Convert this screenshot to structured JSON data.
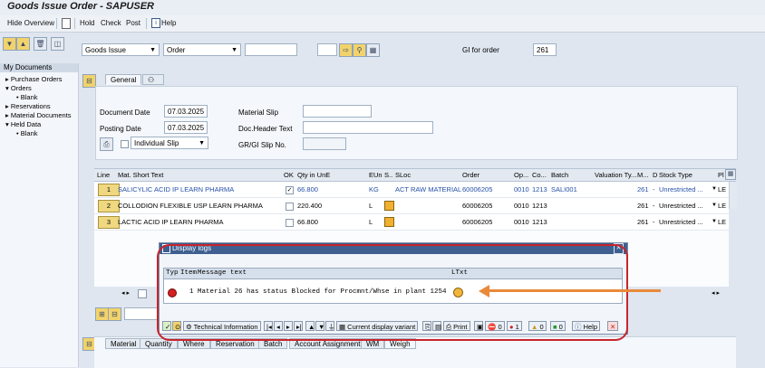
{
  "window": {
    "title": "Goods Issue Order - SAPUSER"
  },
  "toolbar": {
    "hide_overview": "Hide Overview",
    "hold": "Hold",
    "check": "Check",
    "post": "Post",
    "help": "Help",
    "help_glyph": "i"
  },
  "nav": {
    "header": "My Documents",
    "items": [
      {
        "label": "Purchase Orders",
        "marker": "▸"
      },
      {
        "label": "Orders",
        "marker": "▾"
      },
      {
        "label": "Blank",
        "marker": "•"
      },
      {
        "label": "Reservations",
        "marker": "▸"
      },
      {
        "label": "Material Documents",
        "marker": "▸"
      },
      {
        "label": "Held Data",
        "marker": "▾"
      },
      {
        "label": "Blank",
        "marker": "•"
      }
    ]
  },
  "header_row": {
    "transaction": "Goods Issue",
    "reference": "Order",
    "gi_label": "GI for order",
    "movement_type": "261",
    "dropdown_arrow": "▼"
  },
  "tabs": {
    "general": "General"
  },
  "general": {
    "doc_date_label": "Document Date",
    "doc_date": "07.03.2025",
    "post_date_label": "Posting Date",
    "post_date": "07.03.2025",
    "slip_option": "Individual Slip",
    "material_slip_label": "Material Slip",
    "doc_header_label": "Doc.Header Text",
    "gr_gi_slip_label": "GR/GI Slip No."
  },
  "table": {
    "headers": [
      "Line",
      "Mat. Short Text",
      "OK",
      "Qty in UnE",
      "EUn",
      "S..",
      "SLoc",
      "Order",
      "Op...",
      "Co...",
      "Batch",
      "Valuation Ty...",
      "M...",
      "D",
      "Stock Type",
      "Pl"
    ],
    "rows": [
      {
        "line": "1",
        "text": "SALICYLIC ACID IP LEARN PHARMA",
        "ok": "✓",
        "qty": "66.800",
        "eun": "KG",
        "sloc": "ACT RAW MATERIAL",
        "order": "60006205",
        "op": "0010",
        "co": "1213",
        "batch": "SALI001",
        "mvt": "261",
        "dash": "-",
        "stock": "Unrestricted ...",
        "pl": "LE"
      },
      {
        "line": "2",
        "text": "COLLODION FLEXIBLE USP LEARN PHARMA",
        "ok": "",
        "qty": "220.400",
        "eun": "L",
        "sloc": "",
        "order": "60006205",
        "op": "0010",
        "co": "1213",
        "batch": "",
        "mvt": "261",
        "dash": "-",
        "stock": "Unrestricted ...",
        "pl": "LE"
      },
      {
        "line": "3",
        "text": "LACTIC ACID IP LEARN PHARMA",
        "ok": "",
        "qty": "66.800",
        "eun": "L",
        "sloc": "",
        "order": "60006205",
        "op": "0010",
        "co": "1213",
        "batch": "",
        "mvt": "261",
        "dash": "-",
        "stock": "Unrestricted ...",
        "pl": "LE"
      }
    ]
  },
  "dialog": {
    "title": "Display logs",
    "close_glyph": "✕",
    "col_typ": "Typ",
    "col_item": "Item",
    "col_msg": "Message text",
    "col_ltxt": "LTxt",
    "row": {
      "item": "1",
      "message": "Material 26 has status Blocked for Procmnt/Whse in plant 1254"
    },
    "toolbar": {
      "technical_info": "Technical Information",
      "current_variant": "Current display variant",
      "print": "Print",
      "errors": "1",
      "warnings": "0",
      "success": "0",
      "help": "Help",
      "red_count": "0"
    }
  },
  "detail_tabs": [
    "Material",
    "Quantity",
    "Where",
    "Reservation",
    "Batch",
    "Account Assignment",
    "WM",
    "Weigh"
  ],
  "colors": {
    "accent": "#3e5f8f",
    "highlight_oval": "#c8242c",
    "arrow": "#e9893a"
  }
}
